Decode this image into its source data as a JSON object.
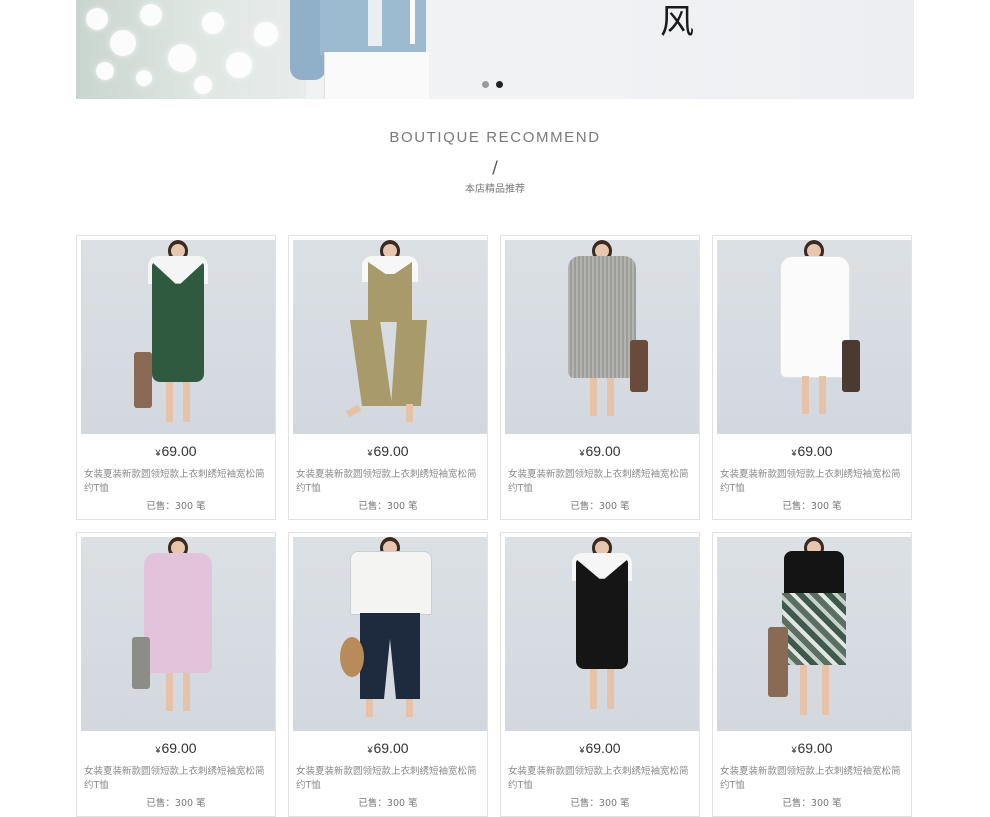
{
  "banner": {
    "char": "风",
    "slides": [
      {
        "active": false
      },
      {
        "active": true
      }
    ]
  },
  "section": {
    "title": "BOUTIQUE RECOMMEND",
    "divider": "/",
    "subtitle": "本店精品推荐"
  },
  "products": [
    {
      "price_symbol": "¥",
      "price": "69.00",
      "title": "女装夏装新款圆领短款上衣刺绣短袖宽松简约T恤",
      "sold": "已售：300 笔",
      "outfit": "green-overall-dress",
      "colors": {
        "main": "#2f5a40",
        "top": "#f5f5f5",
        "bag": "#8a6a55"
      }
    },
    {
      "price_symbol": "¥",
      "price": "69.00",
      "title": "女装夏装新款圆领短款上衣刺绣短袖宽松简约T恤",
      "sold": "已售：300 笔",
      "outfit": "khaki-jumpsuit",
      "colors": {
        "main": "#a89a6a",
        "top": "#f7f7f7",
        "bag": ""
      }
    },
    {
      "price_symbol": "¥",
      "price": "69.00",
      "title": "女装夏装新款圆领短款上衣刺绣短袖宽松简约T恤",
      "sold": "已售：300 笔",
      "outfit": "grey-stripe-dress",
      "colors": {
        "main": "#a9a9a6",
        "top": "#a9a9a6",
        "bag": "#6a4a3a"
      }
    },
    {
      "price_symbol": "¥",
      "price": "69.00",
      "title": "女装夏装新款圆领短款上衣刺绣短袖宽松简约T恤",
      "sold": "已售：300 笔",
      "outfit": "white-shirt-dress",
      "colors": {
        "main": "#fbfbfb",
        "top": "#fbfbfb",
        "bag": "#4a3a32"
      }
    },
    {
      "price_symbol": "¥",
      "price": "69.00",
      "title": "女装夏装新款圆领短款上衣刺绣短袖宽松简约T恤",
      "sold": "已售：300 笔",
      "outfit": "pink-shirt-dress",
      "colors": {
        "main": "#e3c3dc",
        "top": "#e3c3dc",
        "bag": "#8d8d88"
      }
    },
    {
      "price_symbol": "¥",
      "price": "69.00",
      "title": "女装夏装新款圆领短款上衣刺绣短袖宽松简约T恤",
      "sold": "已售：300 笔",
      "outfit": "white-top-navy-pants",
      "colors": {
        "main": "#1e2a3e",
        "top": "#f4f4f2",
        "bag": "#b78b5a"
      }
    },
    {
      "price_symbol": "¥",
      "price": "69.00",
      "title": "女装夏装新款圆领短款上衣刺绣短袖宽松简约T恤",
      "sold": "已售：300 笔",
      "outfit": "black-overall-dress",
      "colors": {
        "main": "#151515",
        "top": "#f6f6f6",
        "bag": ""
      }
    },
    {
      "price_symbol": "¥",
      "price": "69.00",
      "title": "女装夏装新款圆领短款上衣刺绣短袖宽松简约T恤",
      "sold": "已售：300 笔",
      "outfit": "black-top-print-skirt",
      "colors": {
        "main": "#4f6a5a",
        "top": "#141414",
        "bag": "#8a6a55"
      }
    }
  ]
}
